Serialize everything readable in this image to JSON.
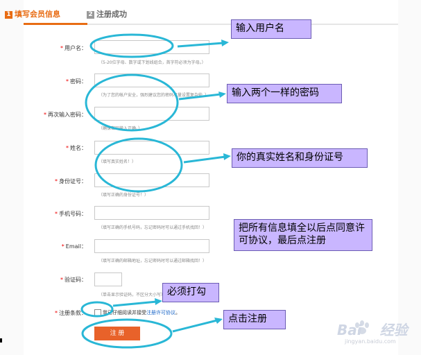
{
  "steps": {
    "step1": {
      "num": "1",
      "label": "填写会员信息"
    },
    "step2": {
      "num": "2",
      "label": "注册成功"
    }
  },
  "form": {
    "username": {
      "label": "用户名：",
      "hint": "（5-20位字母、数字或下划线组合，首字符必须为字母。）"
    },
    "password": {
      "label": "密码：",
      "hint": "（为了您的帐户安全，强烈建议您的密码尽量设置复杂些。）"
    },
    "password_repeat": {
      "label": "再次输入密码：",
      "hint": "（确保密码输入正确。）"
    },
    "name": {
      "label": "姓名：",
      "hint": "（填写真实姓名！）"
    },
    "id_number": {
      "label": "身份证号：",
      "hint": "（填写正确的身份证号！）"
    },
    "phone": {
      "label": "手机号码：",
      "hint": "（填写正确的手机号码，忘记密码时可以通过手机找回！）"
    },
    "email": {
      "label": "Email：",
      "hint": "（填写正确的邮箱地址，忘记密码时可以通过邮箱找回！）"
    },
    "captcha": {
      "label": "验证码：",
      "hint": "（单击显示验证码，不区分大小写）"
    },
    "terms": {
      "label": "注册条款：",
      "text": "我已仔细阅读并接受",
      "link": "注册许可协议",
      "suffix": "。"
    },
    "required_mark": "*",
    "submit_label": "注 册"
  },
  "callouts": {
    "username": "输入用户名",
    "password": "输入两个一样的密码",
    "identity": "你的真实姓名和身份证号",
    "all_info": "把所有信息填全以后点同意许可协议，最后点注册",
    "checkbox": "必须打勾",
    "register": "点击注册"
  },
  "watermark": {
    "brand": "Bai",
    "brand_cn": "经验",
    "url": "jingyan.baidu.com"
  },
  "colors": {
    "accent": "#e86c13",
    "button": "#e8622a",
    "callout_bg": "#c9b6ff",
    "annotation": "#29b7d6",
    "link": "#1a66c8"
  }
}
